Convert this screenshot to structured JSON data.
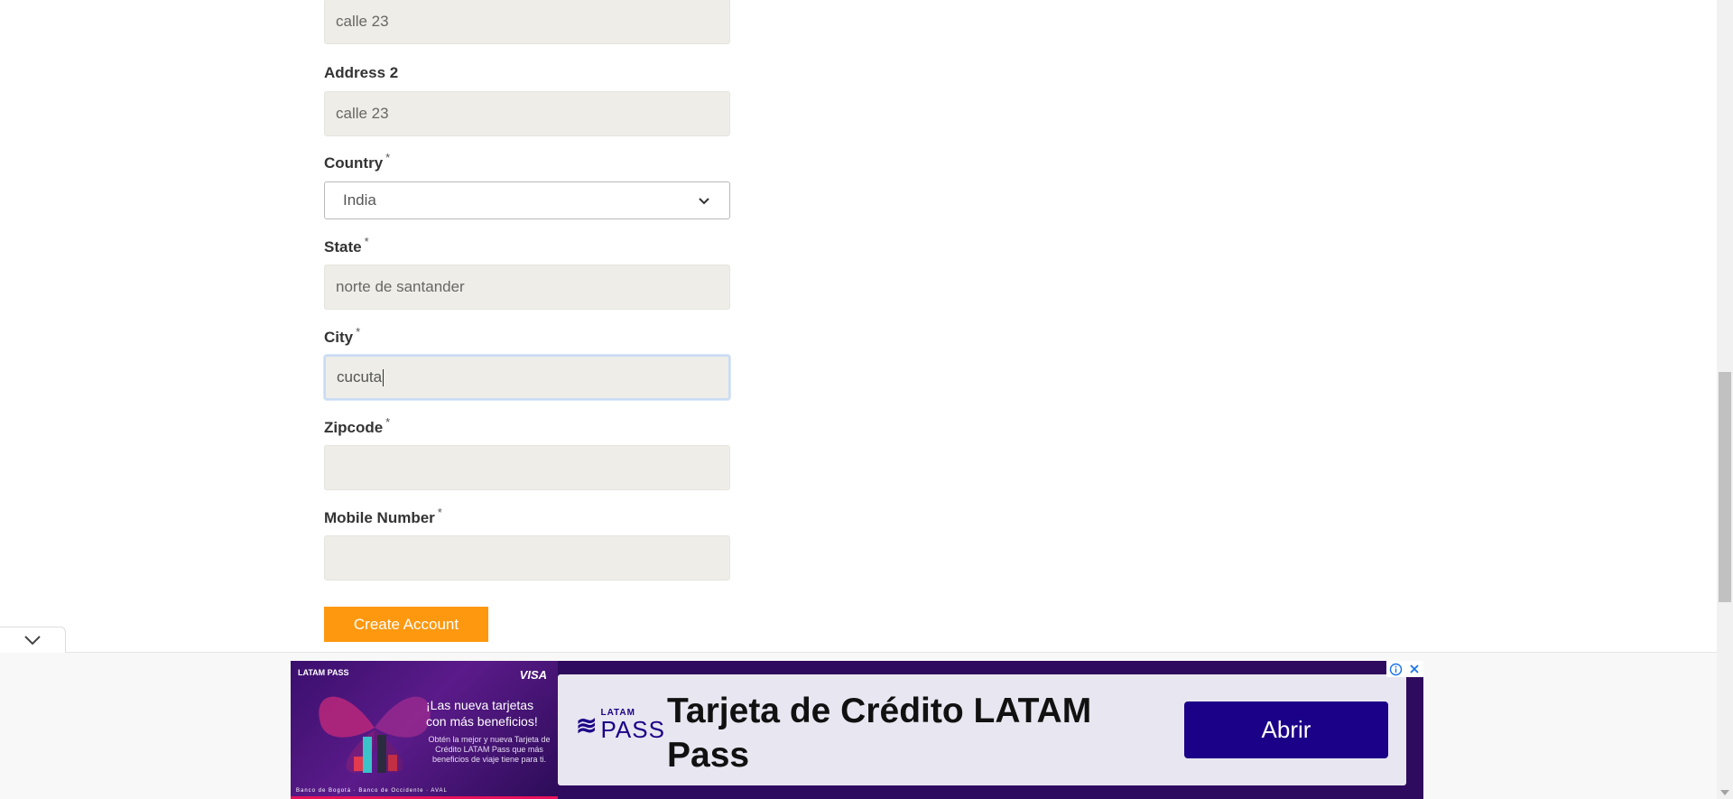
{
  "form": {
    "address1_value": "calle 23",
    "address2_label": "Address 2",
    "address2_value": "calle 23",
    "country_label": "Country",
    "country_value": "India",
    "state_label": "State",
    "state_value": "norte de santander",
    "city_label": "City",
    "city_value": "cucuta",
    "zipcode_label": "Zipcode",
    "zipcode_value": "",
    "mobile_label": "Mobile Number",
    "mobile_value": "",
    "required_mark": "*",
    "create_button": "Create Account"
  },
  "ad": {
    "brand_mini": "LATAM PASS",
    "visa": "VISA",
    "headline": "¡Las nueva tarjetas con más beneficios!",
    "sub": "Obtén la mejor y nueva Tarjeta de Crédito LATAM Pass que más beneficios de viaje tiene para ti.",
    "banks": "Banco de Bogotá · Banco de Occidente · AVAL",
    "logo_small": "LATAM",
    "logo_big": "PASS",
    "title": "Tarjeta de Crédito LATAM Pass",
    "cta": "Abrir"
  },
  "colors": {
    "accent": "#fe980f",
    "ad_brand": "#1b0088",
    "field_bg": "#eeede8"
  },
  "icons": {
    "select_chevron": "chevron-down-icon",
    "ad_collapse": "chevron-down-icon",
    "ad_info": "info-icon",
    "ad_close": "close-icon"
  }
}
